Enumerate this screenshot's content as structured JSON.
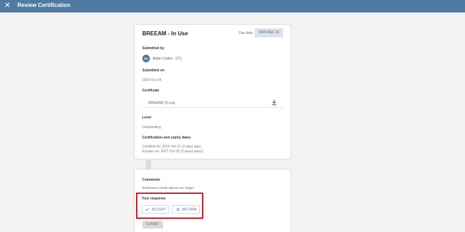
{
  "header": {
    "close_icon": "close-icon",
    "title": "Review Certification"
  },
  "certification": {
    "title": "BREEAM - In Use",
    "due_label": "Due date",
    "due_date": "2024 DEC 31",
    "submitted_by_label": "Submitted by",
    "avatar_initials": "AC",
    "submitter": "Aidan Cullen - CTL",
    "submitted_on_label": "Submitted on",
    "submitted_on": "2024 Oct 04",
    "certificate_label": "Certificate",
    "certificate_file": "BREEAM (3).svg",
    "download_icon": "download-icon",
    "level_label": "Level",
    "level": "Outstanding",
    "dates_label": "Certification and expiry dates",
    "certified_on": "Certified on: 2024 Oct 01 (3 days ago)",
    "expires_on": "Expires on: 2027 Oct 02 (3 years away)"
  },
  "review": {
    "comments_label": "Comments",
    "comment": "Achieved a level above our target",
    "response_label": "Your response",
    "accept_label": "ACCEPT",
    "return_label": "RETURN",
    "submit_label": "SUBMIT"
  },
  "colors": {
    "header": "#4e7aa3",
    "highlight": "#c81e2a",
    "accent": "#4e7aa3"
  }
}
